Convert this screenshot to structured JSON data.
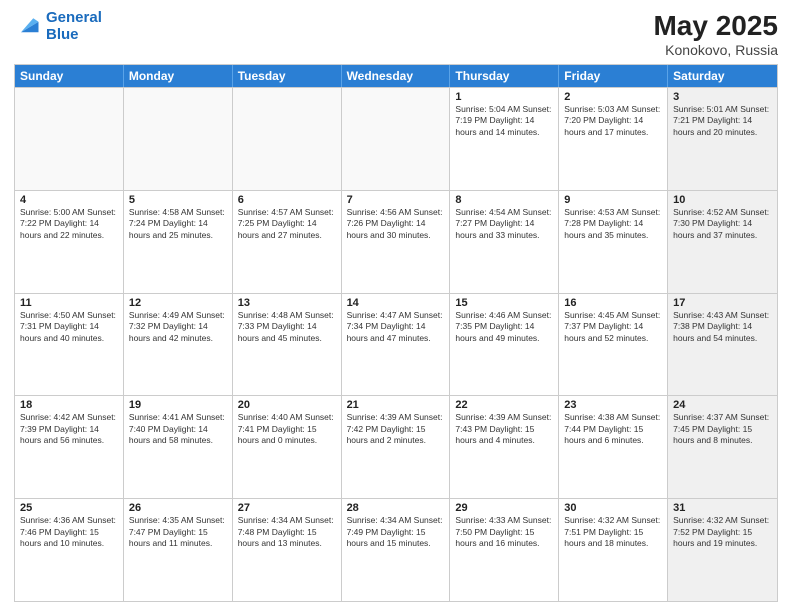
{
  "header": {
    "logo_line1": "General",
    "logo_line2": "Blue",
    "month_year": "May 2025",
    "location": "Konokovo, Russia"
  },
  "days_of_week": [
    "Sunday",
    "Monday",
    "Tuesday",
    "Wednesday",
    "Thursday",
    "Friday",
    "Saturday"
  ],
  "weeks": [
    [
      {
        "day": "",
        "info": "",
        "empty": true
      },
      {
        "day": "",
        "info": "",
        "empty": true
      },
      {
        "day": "",
        "info": "",
        "empty": true
      },
      {
        "day": "",
        "info": "",
        "empty": true
      },
      {
        "day": "1",
        "info": "Sunrise: 5:04 AM\nSunset: 7:19 PM\nDaylight: 14 hours\nand 14 minutes."
      },
      {
        "day": "2",
        "info": "Sunrise: 5:03 AM\nSunset: 7:20 PM\nDaylight: 14 hours\nand 17 minutes."
      },
      {
        "day": "3",
        "info": "Sunrise: 5:01 AM\nSunset: 7:21 PM\nDaylight: 14 hours\nand 20 minutes.",
        "shaded": true
      }
    ],
    [
      {
        "day": "4",
        "info": "Sunrise: 5:00 AM\nSunset: 7:22 PM\nDaylight: 14 hours\nand 22 minutes."
      },
      {
        "day": "5",
        "info": "Sunrise: 4:58 AM\nSunset: 7:24 PM\nDaylight: 14 hours\nand 25 minutes."
      },
      {
        "day": "6",
        "info": "Sunrise: 4:57 AM\nSunset: 7:25 PM\nDaylight: 14 hours\nand 27 minutes."
      },
      {
        "day": "7",
        "info": "Sunrise: 4:56 AM\nSunset: 7:26 PM\nDaylight: 14 hours\nand 30 minutes."
      },
      {
        "day": "8",
        "info": "Sunrise: 4:54 AM\nSunset: 7:27 PM\nDaylight: 14 hours\nand 33 minutes."
      },
      {
        "day": "9",
        "info": "Sunrise: 4:53 AM\nSunset: 7:28 PM\nDaylight: 14 hours\nand 35 minutes."
      },
      {
        "day": "10",
        "info": "Sunrise: 4:52 AM\nSunset: 7:30 PM\nDaylight: 14 hours\nand 37 minutes.",
        "shaded": true
      }
    ],
    [
      {
        "day": "11",
        "info": "Sunrise: 4:50 AM\nSunset: 7:31 PM\nDaylight: 14 hours\nand 40 minutes."
      },
      {
        "day": "12",
        "info": "Sunrise: 4:49 AM\nSunset: 7:32 PM\nDaylight: 14 hours\nand 42 minutes."
      },
      {
        "day": "13",
        "info": "Sunrise: 4:48 AM\nSunset: 7:33 PM\nDaylight: 14 hours\nand 45 minutes."
      },
      {
        "day": "14",
        "info": "Sunrise: 4:47 AM\nSunset: 7:34 PM\nDaylight: 14 hours\nand 47 minutes."
      },
      {
        "day": "15",
        "info": "Sunrise: 4:46 AM\nSunset: 7:35 PM\nDaylight: 14 hours\nand 49 minutes."
      },
      {
        "day": "16",
        "info": "Sunrise: 4:45 AM\nSunset: 7:37 PM\nDaylight: 14 hours\nand 52 minutes."
      },
      {
        "day": "17",
        "info": "Sunrise: 4:43 AM\nSunset: 7:38 PM\nDaylight: 14 hours\nand 54 minutes.",
        "shaded": true
      }
    ],
    [
      {
        "day": "18",
        "info": "Sunrise: 4:42 AM\nSunset: 7:39 PM\nDaylight: 14 hours\nand 56 minutes."
      },
      {
        "day": "19",
        "info": "Sunrise: 4:41 AM\nSunset: 7:40 PM\nDaylight: 14 hours\nand 58 minutes."
      },
      {
        "day": "20",
        "info": "Sunrise: 4:40 AM\nSunset: 7:41 PM\nDaylight: 15 hours\nand 0 minutes."
      },
      {
        "day": "21",
        "info": "Sunrise: 4:39 AM\nSunset: 7:42 PM\nDaylight: 15 hours\nand 2 minutes."
      },
      {
        "day": "22",
        "info": "Sunrise: 4:39 AM\nSunset: 7:43 PM\nDaylight: 15 hours\nand 4 minutes."
      },
      {
        "day": "23",
        "info": "Sunrise: 4:38 AM\nSunset: 7:44 PM\nDaylight: 15 hours\nand 6 minutes."
      },
      {
        "day": "24",
        "info": "Sunrise: 4:37 AM\nSunset: 7:45 PM\nDaylight: 15 hours\nand 8 minutes.",
        "shaded": true
      }
    ],
    [
      {
        "day": "25",
        "info": "Sunrise: 4:36 AM\nSunset: 7:46 PM\nDaylight: 15 hours\nand 10 minutes."
      },
      {
        "day": "26",
        "info": "Sunrise: 4:35 AM\nSunset: 7:47 PM\nDaylight: 15 hours\nand 11 minutes."
      },
      {
        "day": "27",
        "info": "Sunrise: 4:34 AM\nSunset: 7:48 PM\nDaylight: 15 hours\nand 13 minutes."
      },
      {
        "day": "28",
        "info": "Sunrise: 4:34 AM\nSunset: 7:49 PM\nDaylight: 15 hours\nand 15 minutes."
      },
      {
        "day": "29",
        "info": "Sunrise: 4:33 AM\nSunset: 7:50 PM\nDaylight: 15 hours\nand 16 minutes."
      },
      {
        "day": "30",
        "info": "Sunrise: 4:32 AM\nSunset: 7:51 PM\nDaylight: 15 hours\nand 18 minutes."
      },
      {
        "day": "31",
        "info": "Sunrise: 4:32 AM\nSunset: 7:52 PM\nDaylight: 15 hours\nand 19 minutes.",
        "shaded": true
      }
    ]
  ]
}
